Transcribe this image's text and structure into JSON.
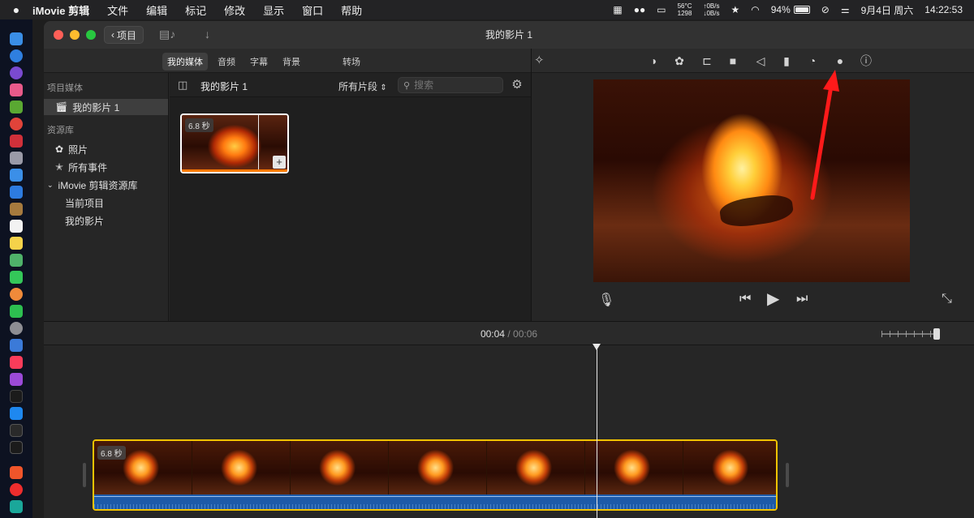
{
  "menubar": {
    "apple_icon": "apple-icon",
    "app_name": "iMovie 剪辑",
    "menus": [
      "文件",
      "编辑",
      "标记",
      "修改",
      "显示",
      "窗口",
      "帮助"
    ],
    "cpu_temp": "56°C",
    "cpu_rpm": "1298",
    "net_up": "↑0B/s",
    "net_down": "↓0B/s",
    "battery": "94%",
    "date": "9月4日 周六",
    "time": "14:22:53"
  },
  "window": {
    "back_label": "项目",
    "title": "我的影片 1"
  },
  "tabs": [
    "我的媒体",
    "音频",
    "字幕",
    "背景",
    "转场"
  ],
  "sidebar": {
    "project_header": "项目媒体",
    "project_item": "我的影片 1",
    "library_header": "资源库",
    "photos": "照片",
    "all_events": "所有事件",
    "library_name": "iMovie 剪辑资源库",
    "current_project": "当前项目",
    "my_movies": "我的影片"
  },
  "browser": {
    "title": "我的影片 1",
    "filter": "所有片段",
    "search_placeholder": "搜索",
    "clip_duration": "6.8 秒"
  },
  "timeline": {
    "current": "00:04",
    "separator": "/",
    "total": "00:06",
    "clip_duration": "6.8 秒"
  },
  "colors": {
    "accent_yellow": "#f2c300",
    "audio_blue": "#1d5aa8",
    "annotation_red": "#ff1a1a"
  }
}
